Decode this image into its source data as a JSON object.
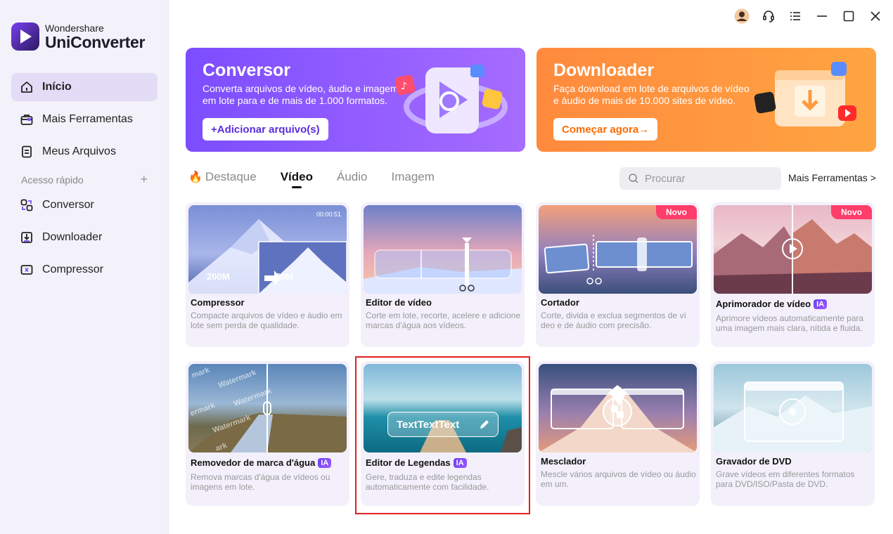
{
  "brand": {
    "small": "Wondershare",
    "big": "UniConverter"
  },
  "sidebar": {
    "items": [
      {
        "label": "Início",
        "icon": "home-icon",
        "active": true
      },
      {
        "label": "Mais Ferramentas",
        "icon": "toolbox-icon"
      },
      {
        "label": "Meus Arquivos",
        "icon": "file-icon"
      }
    ],
    "quick_access_label": "Acesso rápido",
    "quick_items": [
      {
        "label": "Conversor",
        "icon": "convert-icon"
      },
      {
        "label": "Downloader",
        "icon": "download-icon"
      },
      {
        "label": "Compressor",
        "icon": "compress-icon"
      }
    ]
  },
  "banners": {
    "converter": {
      "title": "Conversor",
      "desc": "Converta arquivos de vídeo, áudio e imagem em lote para e de mais de 1.000 formatos.",
      "cta": "+Adicionar arquivo(s)"
    },
    "downloader": {
      "title": "Downloader",
      "desc": "Faça download em lote de arquivos de vídeo e áudio de mais de 10.000 sites de vídeo.",
      "cta": "Começar agora→"
    }
  },
  "tabs": [
    {
      "label": "Destaque",
      "icon": "fire-icon"
    },
    {
      "label": "Vídeo",
      "active": true
    },
    {
      "label": "Áudio"
    },
    {
      "label": "Imagem"
    }
  ],
  "search": {
    "placeholder": "Procurar"
  },
  "more_tools": "Mais Ferramentas  >",
  "cards": [
    {
      "title": "Compressor",
      "desc": "Compacte arquivos de vídeo e áudio em lote sem perda de qualidade.",
      "thumb_from": "200M",
      "thumb_to": "20M",
      "thumb_time": "00:00:51"
    },
    {
      "title": "Editor de vídeo",
      "desc": "Corte em lote, recorte, acelere e adicione marcas d'água aos vídeos."
    },
    {
      "title": "Cortador",
      "desc": "Corte, divida e exclua segmentos de ví deo e de áudio com precisão.",
      "badge": "Novo"
    },
    {
      "title": "Aprimorador de vídeo",
      "ia": "IA",
      "desc": "Aprimore vídeos automaticamente para uma imagem mais clara, nítida e fluida.",
      "badge": "Novo"
    },
    {
      "title": "Removedor de marca d'água",
      "ia": "IA",
      "desc": "Remova marcas d'água de vídeos ou imagens em lote.",
      "thumb_text": "Watermark"
    },
    {
      "title": "Editor de Legendas",
      "ia": "IA",
      "desc": "Gere, traduza e edite legendas automaticamente com facilidade.",
      "thumb_text": "TextTextText"
    },
    {
      "title": "Mesclador",
      "desc": "Mescle vários arquivos de vídeo ou áudio em um."
    },
    {
      "title": "Gravador de DVD",
      "desc": "Grave vídeos em diferentes formatos para DVD/ISO/Pasta de DVD."
    }
  ],
  "colors": {
    "accent": "#7c4dff",
    "downloader": "#ff8a3d",
    "novo": "#ff3d6a",
    "highlight": "#e02020"
  }
}
